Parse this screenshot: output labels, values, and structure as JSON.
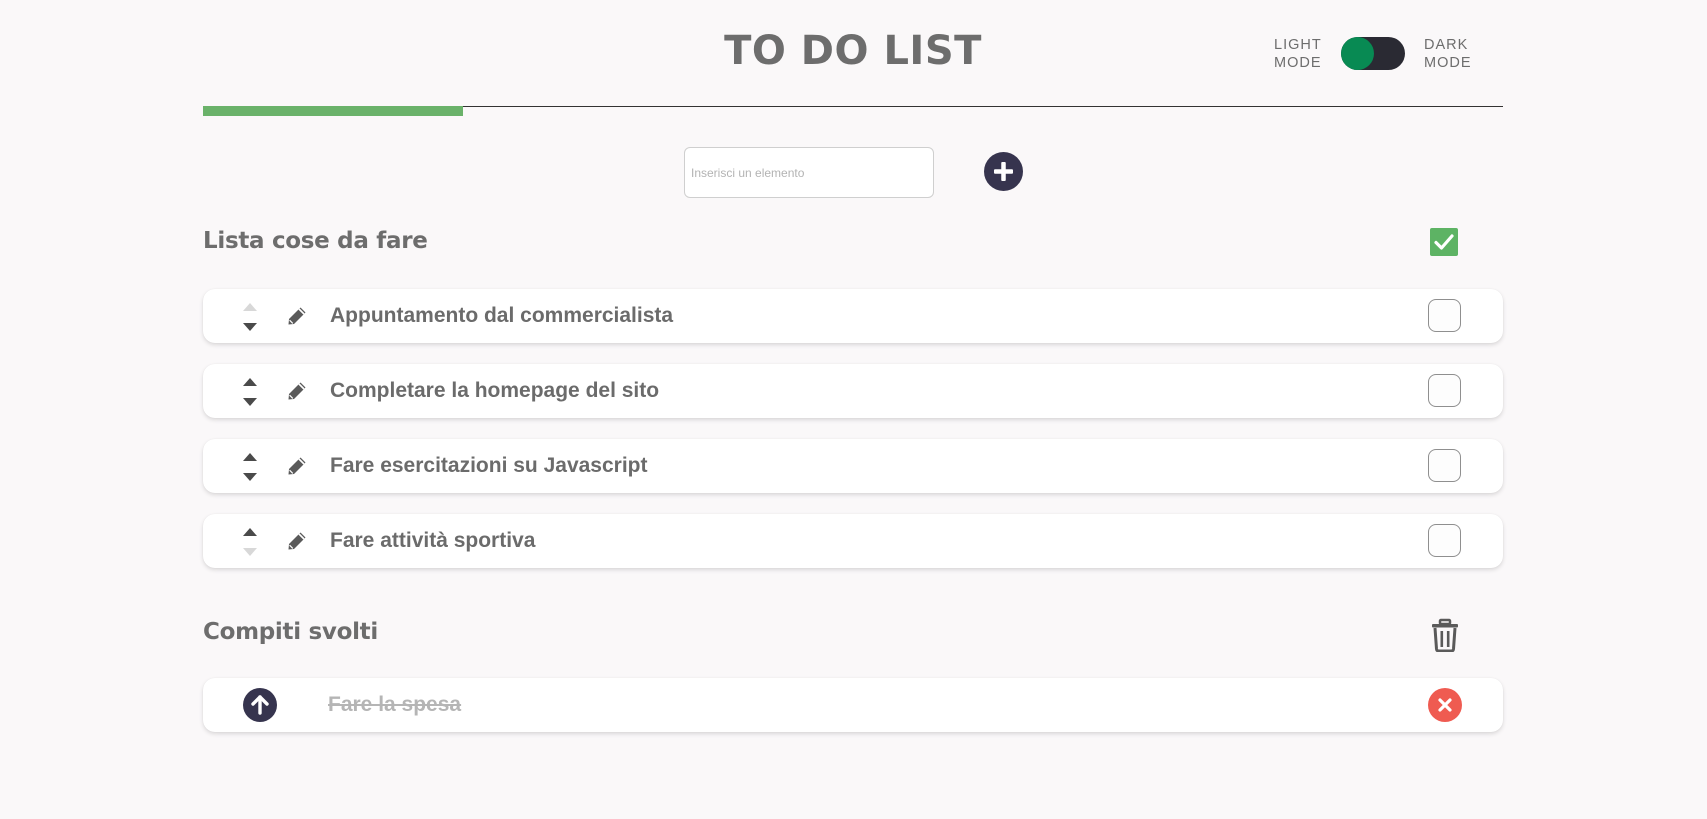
{
  "header": {
    "title": "TO DO LIST",
    "light_label_1": "LIGHT",
    "light_label_2": "MODE",
    "dark_label_1": "DARK",
    "dark_label_2": "MODE",
    "mode": "light",
    "progress_fraction": 0.2
  },
  "add": {
    "placeholder": "Inserisci un elemento",
    "value": ""
  },
  "todo": {
    "title": "Lista cose da fare",
    "items": [
      {
        "label": "Appuntamento dal commercialista"
      },
      {
        "label": "Completare la homepage del sito"
      },
      {
        "label": "Fare esercitazioni su Javascript"
      },
      {
        "label": "Fare attività sportiva"
      }
    ]
  },
  "done": {
    "title": "Compiti svolti",
    "items": [
      {
        "label": "Fare la spesa"
      }
    ]
  },
  "colors": {
    "toggle_knob": "#088a53",
    "progress": "#6ab26a",
    "check_all": "#5db364",
    "primary_button": "#36344e",
    "remove_button": "#ef5b51"
  },
  "icons": [
    "plus-icon",
    "check-icon",
    "pencil-icon",
    "arrow-up-icon",
    "trash-icon",
    "close-icon"
  ]
}
